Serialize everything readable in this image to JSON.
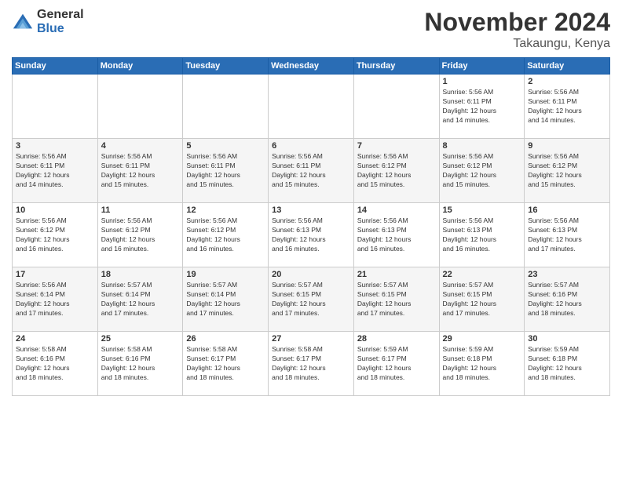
{
  "logo": {
    "general": "General",
    "blue": "Blue"
  },
  "header": {
    "month_year": "November 2024",
    "location": "Takaungu, Kenya"
  },
  "days_of_week": [
    "Sunday",
    "Monday",
    "Tuesday",
    "Wednesday",
    "Thursday",
    "Friday",
    "Saturday"
  ],
  "weeks": [
    [
      {
        "day": "",
        "info": ""
      },
      {
        "day": "",
        "info": ""
      },
      {
        "day": "",
        "info": ""
      },
      {
        "day": "",
        "info": ""
      },
      {
        "day": "",
        "info": ""
      },
      {
        "day": "1",
        "info": "Sunrise: 5:56 AM\nSunset: 6:11 PM\nDaylight: 12 hours\nand 14 minutes."
      },
      {
        "day": "2",
        "info": "Sunrise: 5:56 AM\nSunset: 6:11 PM\nDaylight: 12 hours\nand 14 minutes."
      }
    ],
    [
      {
        "day": "3",
        "info": "Sunrise: 5:56 AM\nSunset: 6:11 PM\nDaylight: 12 hours\nand 14 minutes."
      },
      {
        "day": "4",
        "info": "Sunrise: 5:56 AM\nSunset: 6:11 PM\nDaylight: 12 hours\nand 15 minutes."
      },
      {
        "day": "5",
        "info": "Sunrise: 5:56 AM\nSunset: 6:11 PM\nDaylight: 12 hours\nand 15 minutes."
      },
      {
        "day": "6",
        "info": "Sunrise: 5:56 AM\nSunset: 6:11 PM\nDaylight: 12 hours\nand 15 minutes."
      },
      {
        "day": "7",
        "info": "Sunrise: 5:56 AM\nSunset: 6:12 PM\nDaylight: 12 hours\nand 15 minutes."
      },
      {
        "day": "8",
        "info": "Sunrise: 5:56 AM\nSunset: 6:12 PM\nDaylight: 12 hours\nand 15 minutes."
      },
      {
        "day": "9",
        "info": "Sunrise: 5:56 AM\nSunset: 6:12 PM\nDaylight: 12 hours\nand 15 minutes."
      }
    ],
    [
      {
        "day": "10",
        "info": "Sunrise: 5:56 AM\nSunset: 6:12 PM\nDaylight: 12 hours\nand 16 minutes."
      },
      {
        "day": "11",
        "info": "Sunrise: 5:56 AM\nSunset: 6:12 PM\nDaylight: 12 hours\nand 16 minutes."
      },
      {
        "day": "12",
        "info": "Sunrise: 5:56 AM\nSunset: 6:12 PM\nDaylight: 12 hours\nand 16 minutes."
      },
      {
        "day": "13",
        "info": "Sunrise: 5:56 AM\nSunset: 6:13 PM\nDaylight: 12 hours\nand 16 minutes."
      },
      {
        "day": "14",
        "info": "Sunrise: 5:56 AM\nSunset: 6:13 PM\nDaylight: 12 hours\nand 16 minutes."
      },
      {
        "day": "15",
        "info": "Sunrise: 5:56 AM\nSunset: 6:13 PM\nDaylight: 12 hours\nand 16 minutes."
      },
      {
        "day": "16",
        "info": "Sunrise: 5:56 AM\nSunset: 6:13 PM\nDaylight: 12 hours\nand 17 minutes."
      }
    ],
    [
      {
        "day": "17",
        "info": "Sunrise: 5:56 AM\nSunset: 6:14 PM\nDaylight: 12 hours\nand 17 minutes."
      },
      {
        "day": "18",
        "info": "Sunrise: 5:57 AM\nSunset: 6:14 PM\nDaylight: 12 hours\nand 17 minutes."
      },
      {
        "day": "19",
        "info": "Sunrise: 5:57 AM\nSunset: 6:14 PM\nDaylight: 12 hours\nand 17 minutes."
      },
      {
        "day": "20",
        "info": "Sunrise: 5:57 AM\nSunset: 6:15 PM\nDaylight: 12 hours\nand 17 minutes."
      },
      {
        "day": "21",
        "info": "Sunrise: 5:57 AM\nSunset: 6:15 PM\nDaylight: 12 hours\nand 17 minutes."
      },
      {
        "day": "22",
        "info": "Sunrise: 5:57 AM\nSunset: 6:15 PM\nDaylight: 12 hours\nand 17 minutes."
      },
      {
        "day": "23",
        "info": "Sunrise: 5:57 AM\nSunset: 6:16 PM\nDaylight: 12 hours\nand 18 minutes."
      }
    ],
    [
      {
        "day": "24",
        "info": "Sunrise: 5:58 AM\nSunset: 6:16 PM\nDaylight: 12 hours\nand 18 minutes."
      },
      {
        "day": "25",
        "info": "Sunrise: 5:58 AM\nSunset: 6:16 PM\nDaylight: 12 hours\nand 18 minutes."
      },
      {
        "day": "26",
        "info": "Sunrise: 5:58 AM\nSunset: 6:17 PM\nDaylight: 12 hours\nand 18 minutes."
      },
      {
        "day": "27",
        "info": "Sunrise: 5:58 AM\nSunset: 6:17 PM\nDaylight: 12 hours\nand 18 minutes."
      },
      {
        "day": "28",
        "info": "Sunrise: 5:59 AM\nSunset: 6:17 PM\nDaylight: 12 hours\nand 18 minutes."
      },
      {
        "day": "29",
        "info": "Sunrise: 5:59 AM\nSunset: 6:18 PM\nDaylight: 12 hours\nand 18 minutes."
      },
      {
        "day": "30",
        "info": "Sunrise: 5:59 AM\nSunset: 6:18 PM\nDaylight: 12 hours\nand 18 minutes."
      }
    ]
  ]
}
